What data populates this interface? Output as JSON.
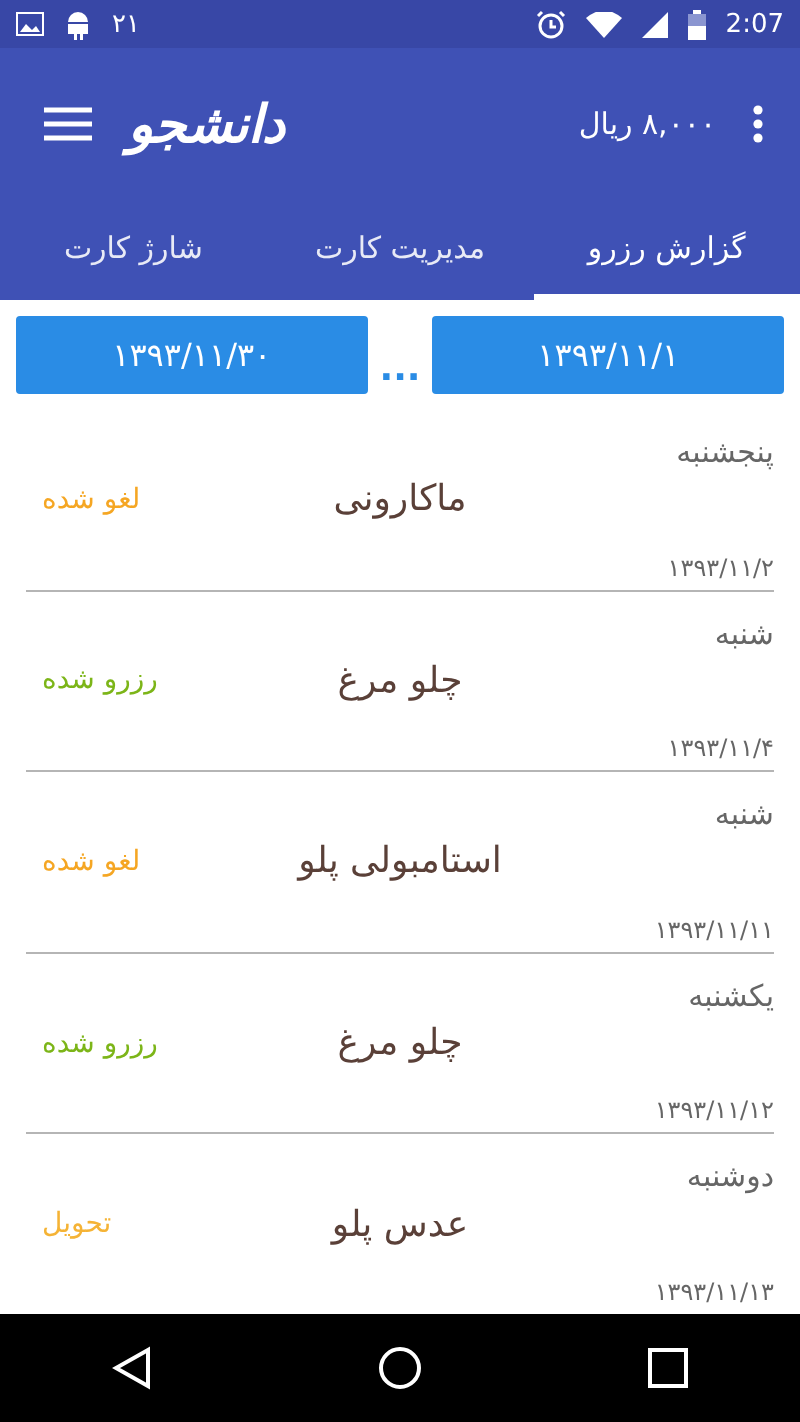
{
  "status_bar": {
    "notification_count": "۲۱",
    "time": "2:07"
  },
  "app_bar": {
    "logo": "دانشجو",
    "balance": "۸,۰۰۰ ریال"
  },
  "tabs": [
    {
      "label": "گزارش رزرو",
      "selected": true
    },
    {
      "label": "مدیریت کارت",
      "selected": false
    },
    {
      "label": "شارژ کارت",
      "selected": false
    }
  ],
  "date_range": {
    "from": "۱۳۹۳/۱۱/۱",
    "separator": "...",
    "to": "۱۳۹۳/۱۱/۳۰"
  },
  "reservations": [
    {
      "day": "پنجشنبه",
      "date": "۱۳۹۳/۱۱/۲",
      "meal": "ماکارونی",
      "status": "لغو شده",
      "color": "#f5a623"
    },
    {
      "day": "شنبه",
      "date": "۱۳۹۳/۱۱/۴",
      "meal": "چلو مرغ",
      "status": "رزرو شده",
      "color": "#7cb518"
    },
    {
      "day": "شنبه",
      "date": "۱۳۹۳/۱۱/۱۱",
      "meal": "استامبولی پلو",
      "status": "لغو شده",
      "color": "#f5a623"
    },
    {
      "day": "یکشنبه",
      "date": "۱۳۹۳/۱۱/۱۲",
      "meal": "چلو مرغ",
      "status": "رزرو شده",
      "color": "#7cb518"
    },
    {
      "day": "دوشنبه",
      "date": "۱۳۹۳/۱۱/۱۳",
      "meal": "عدس پلو",
      "status": "تحویل",
      "color": "#f5b335"
    }
  ]
}
